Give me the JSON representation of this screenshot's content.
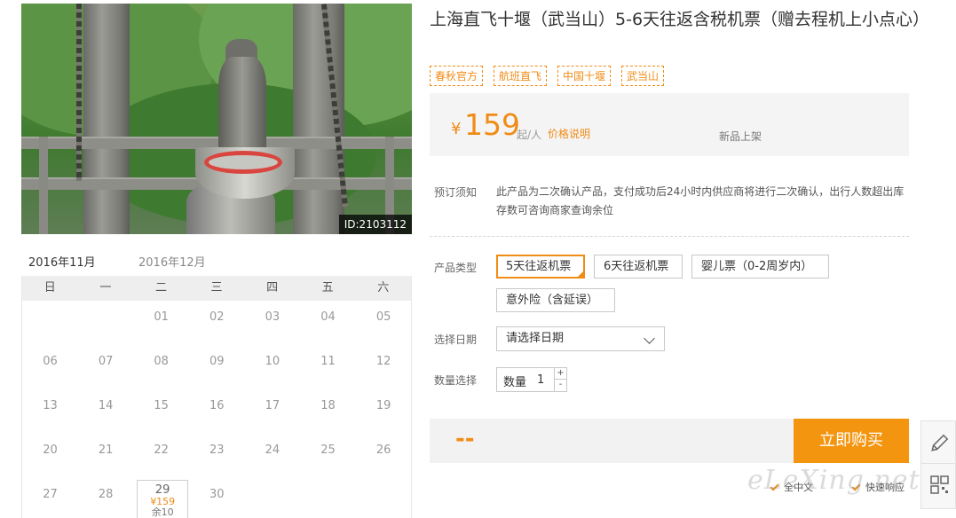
{
  "photo": {
    "id_label": "ID:2103112"
  },
  "calendar": {
    "months": [
      "2016年11月",
      "2016年12月"
    ],
    "weekdays": [
      "日",
      "一",
      "二",
      "三",
      "四",
      "五",
      "六"
    ],
    "rows": [
      [
        "",
        "",
        "01",
        "02",
        "03",
        "04",
        "05"
      ],
      [
        "06",
        "07",
        "08",
        "09",
        "10",
        "11",
        "12"
      ],
      [
        "13",
        "14",
        "15",
        "16",
        "17",
        "18",
        "19"
      ],
      [
        "20",
        "21",
        "22",
        "23",
        "24",
        "25",
        "26"
      ],
      [
        "27",
        "28",
        "29",
        "30",
        "",
        "",
        ""
      ]
    ],
    "available": {
      "day": "29",
      "price": "¥159",
      "stock": "余10"
    }
  },
  "product": {
    "title": "上海直飞十堰（武当山）5-6天往返含税机票（赠去程机上小点心）",
    "tags": [
      "春秋官方",
      "航班直飞",
      "中国十堰",
      "武当山"
    ]
  },
  "price": {
    "currency": "¥",
    "amount": "159",
    "unit": "起/人",
    "explain": "价格说明",
    "badge": "新品上架"
  },
  "notice": {
    "label": "预订须知",
    "text": "此产品为二次确认产品，支付成功后24小时内供应商将进行二次确认，出行人数超出库存数可咨询商家查询余位"
  },
  "product_type": {
    "label": "产品类型",
    "options": [
      "5天往返机票",
      "6天往返机票",
      "婴儿票（0-2周岁内）",
      "意外险（含延误）"
    ],
    "selected_index": 0
  },
  "date_select": {
    "label": "选择日期",
    "value": "请选择日期"
  },
  "quantity": {
    "label": "数量选择",
    "inner_label": "数量",
    "value": "1",
    "plus": "+",
    "minus": "-"
  },
  "buy": {
    "total": "--",
    "button": "立即购买"
  },
  "assurances": [
    "全中文",
    "快速响应"
  ],
  "watermark": "eLeXing.net",
  "colors": {
    "accent": "#f08c16",
    "button": "#f3950f"
  }
}
